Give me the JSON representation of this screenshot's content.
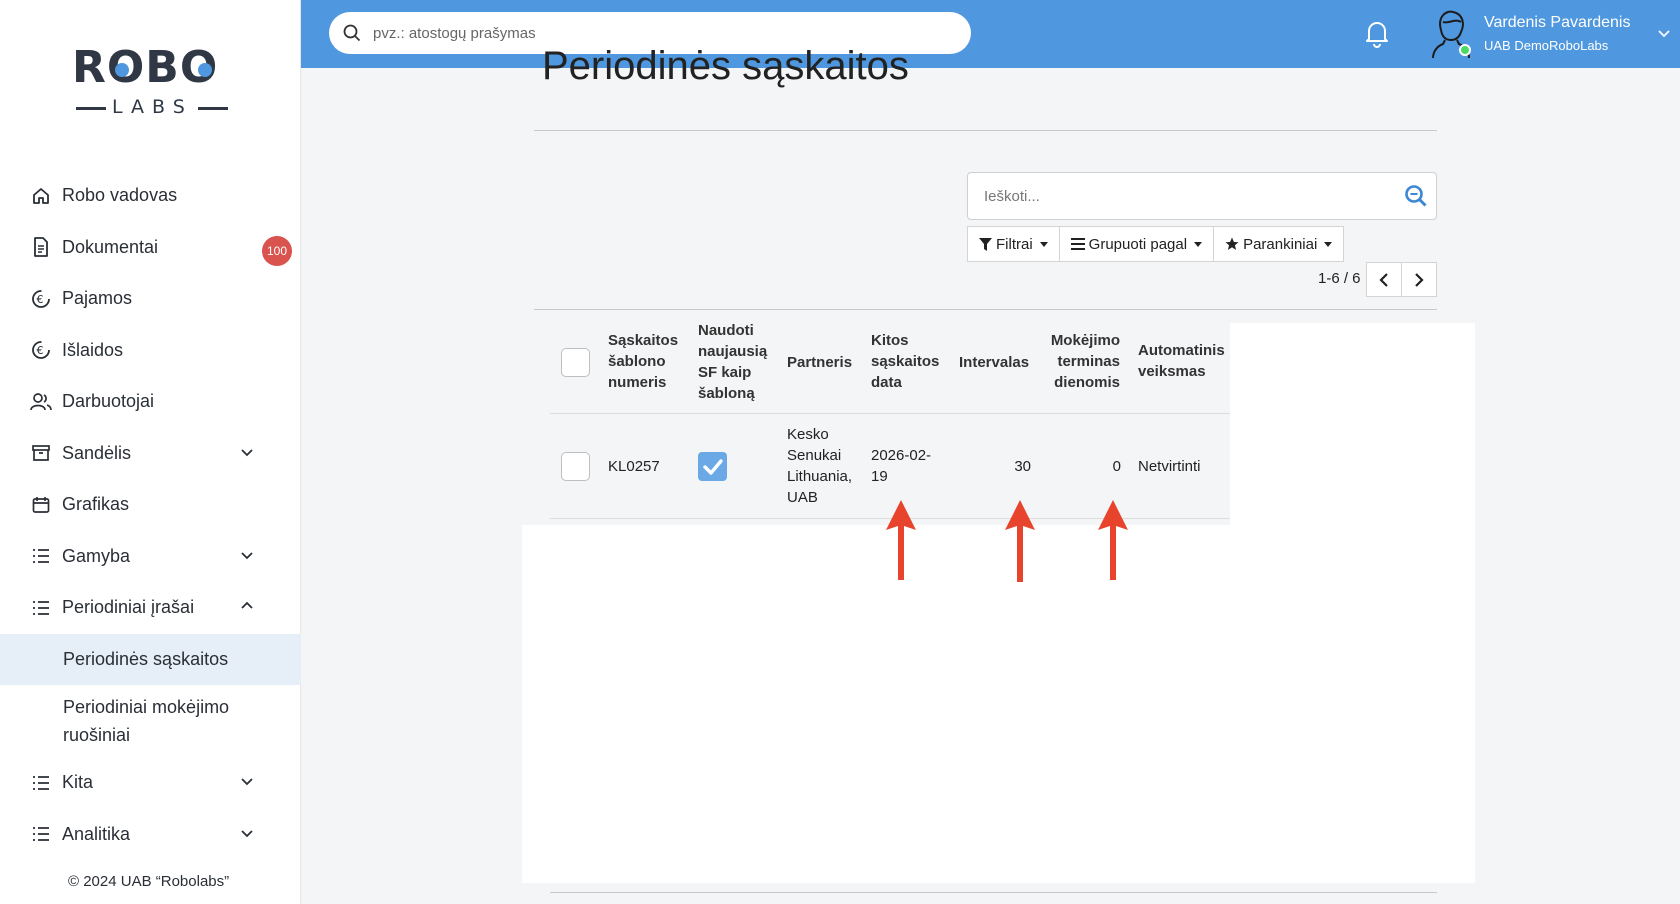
{
  "logo": {
    "word": "ROBO",
    "sub": "LABS"
  },
  "sidebar": {
    "items": [
      {
        "label": "Robo vadovas",
        "icon": "home-icon"
      },
      {
        "label": "Dokumentai",
        "icon": "document-icon",
        "badge": "100"
      },
      {
        "label": "Pajamos",
        "icon": "euro-icon"
      },
      {
        "label": "Išlaidos",
        "icon": "euro-icon"
      },
      {
        "label": "Darbuotojai",
        "icon": "users-icon"
      },
      {
        "label": "Sandėlis",
        "icon": "archive-icon"
      },
      {
        "label": "Grafikas",
        "icon": "calendar-icon"
      },
      {
        "label": "Gamyba",
        "icon": "list-icon"
      },
      {
        "label": "Periodiniai įrašai",
        "icon": "list-icon"
      },
      {
        "label": "Kita",
        "icon": "list-icon"
      },
      {
        "label": "Analitika",
        "icon": "list-icon"
      }
    ],
    "subitems": [
      {
        "label": "Periodinės sąskaitos"
      },
      {
        "label_line1": "Periodiniai mokėjimo",
        "label_line2": "ruošiniai"
      }
    ],
    "footer": "© 2024 UAB “Robolabs”"
  },
  "topbar": {
    "search_placeholder": "pvz.: atostogų prašymas",
    "user_name": "Vardenis Pavardenis",
    "company": "UAB DemoRoboLabs"
  },
  "main": {
    "title": "Periodinės sąskaitos",
    "search_placeholder": "Ieškoti...",
    "buttons": {
      "filters": "Filtrai",
      "group_by": "Grupuoti pagal",
      "favorites": "Parankiniai"
    },
    "pager": "1-6 / 6"
  },
  "table": {
    "headers": {
      "number": [
        "Sąskaitos",
        "šablono",
        "numeris"
      ],
      "use_latest": [
        "Naudoti",
        "naujausią",
        "SF kaip",
        "šabloną"
      ],
      "partner": "Partneris",
      "next_date": [
        "Kitos",
        "sąskaitos",
        "data"
      ],
      "interval": "Intervalas",
      "payment_term": [
        "Mokėjimo",
        "terminas",
        "dienomis"
      ],
      "auto_action": [
        "Automatinis",
        "veiksmas"
      ]
    },
    "rows": [
      {
        "number": "KL0257",
        "use_latest": true,
        "partner": [
          "Kesko",
          "Senukai",
          "Lithuania,",
          "UAB"
        ],
        "next_date": [
          "2026-02-",
          "19"
        ],
        "interval": "30",
        "payment_term": "0",
        "auto_action": "Netvirtinti"
      }
    ]
  },
  "colors": {
    "topbar": "#4f97de",
    "badge": "#d9534f",
    "arrow": "#e8432c",
    "active_bg": "#e6eef7"
  }
}
